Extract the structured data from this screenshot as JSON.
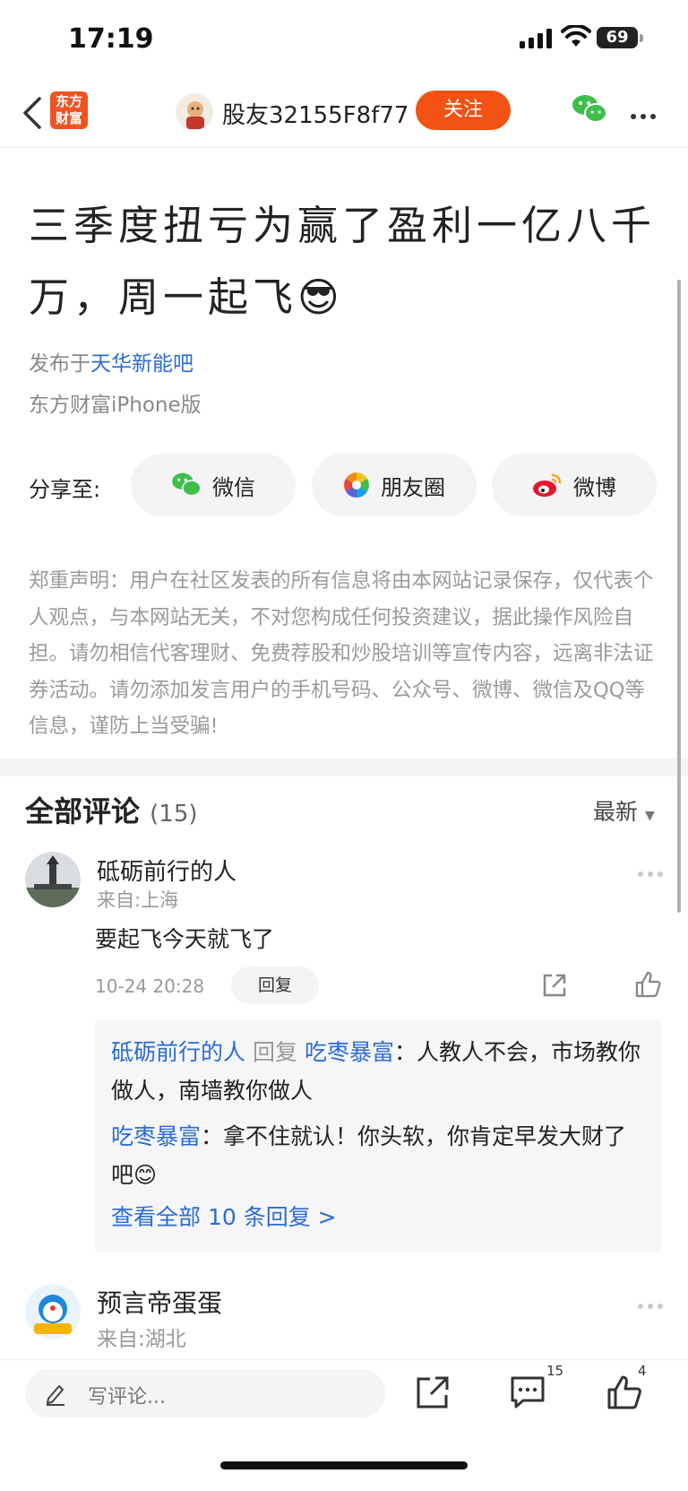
{
  "status_bar": {
    "time": "17:19",
    "battery": "69"
  },
  "nav": {
    "app_logo_line1": "东方",
    "app_logo_line2": "财富",
    "user_name": "股友32155F8f77",
    "follow_label": "关注"
  },
  "post": {
    "title": "三季度扭亏为赢了盈利一亿八千万，周一起飞",
    "emoji": "😎",
    "published_prefix": "发布于",
    "bar_name": "天华新能吧",
    "client": "东方财富iPhone版"
  },
  "share": {
    "label": "分享至:",
    "items": [
      {
        "label": "微信",
        "icon": "wechat-icon"
      },
      {
        "label": "朋友圈",
        "icon": "moments-icon"
      },
      {
        "label": "微博",
        "icon": "weibo-icon"
      }
    ]
  },
  "disclaimer": "郑重声明：用户在社区发表的所有信息将由本网站记录保存，仅代表个人观点，与本网站无关，不对您构成任何投资建议，据此操作风险自担。请勿相信代客理财、免费荐股和炒股培训等宣传内容，远离非法证券活动。请勿添加发言用户的手机号码、公众号、微博、微信及QQ等信息，谨防上当受骗!",
  "comments_header": {
    "title": "全部评论",
    "count": "(15)",
    "sort_label": "最新"
  },
  "comments": [
    {
      "name": "砥砺前行的人",
      "location": "来自:上海",
      "text": "要起飞今天就飞了",
      "time": "10-24 20:28",
      "reply_label": "回复",
      "replies": [
        {
          "from": "砥砺前行的人",
          "verb": "回复",
          "to": "吃枣暴富",
          "text": "：人教人不会，市场教你做人，南墙教你做人"
        },
        {
          "from": "吃枣暴富",
          "text": "：拿不住就认！你头软，你肯定早发大财了吧",
          "emoji": "😊"
        }
      ],
      "view_all": "查看全部 10 条回复 >"
    },
    {
      "name": "预言帝蛋蛋",
      "location": "来自:湖北"
    }
  ],
  "bottom_bar": {
    "write_placeholder": "写评论...",
    "comment_count": "15",
    "like_count": "4"
  },
  "colors": {
    "accent": "#f25214",
    "link": "#2b6cd6",
    "muted": "#999999"
  }
}
